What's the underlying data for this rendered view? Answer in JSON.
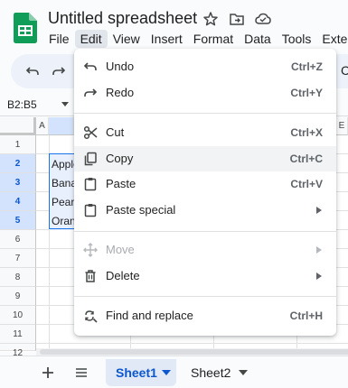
{
  "app": {
    "title": "Untitled spreadsheet",
    "menu": [
      "File",
      "Edit",
      "View",
      "Insert",
      "Format",
      "Data",
      "Tools",
      "Exte"
    ],
    "active_menu": "Edit"
  },
  "toolbar": {
    "overflow_letter": "C"
  },
  "formula_bar": {
    "range": "B2:B5"
  },
  "grid": {
    "columns": [
      "A",
      "",
      "E"
    ],
    "rows": [
      "1",
      "2",
      "3",
      "4",
      "5",
      "6",
      "7",
      "8",
      "9",
      "10",
      "11",
      "12"
    ],
    "selected_rows": [
      "2",
      "3",
      "4",
      "5"
    ],
    "cells_b": [
      "Apple",
      "Banana",
      "Pears",
      "Oranges"
    ]
  },
  "sheets": {
    "tabs": [
      "Sheet1",
      "Sheet2"
    ],
    "active": "Sheet1"
  },
  "edit_menu": {
    "items": [
      {
        "label": "Undo",
        "shortcut": "Ctrl+Z",
        "icon": "undo-icon"
      },
      {
        "label": "Redo",
        "shortcut": "Ctrl+Y",
        "icon": "redo-icon"
      },
      {
        "label": "Cut",
        "shortcut": "Ctrl+X",
        "icon": "scissors-icon"
      },
      {
        "label": "Copy",
        "shortcut": "Ctrl+C",
        "icon": "copy-icon"
      },
      {
        "label": "Paste",
        "shortcut": "Ctrl+V",
        "icon": "clipboard-icon"
      },
      {
        "label": "Paste special",
        "shortcut": "",
        "icon": "clipboard-icon"
      },
      {
        "label": "Move",
        "shortcut": "",
        "icon": "move-icon",
        "disabled": true
      },
      {
        "label": "Delete",
        "shortcut": "",
        "icon": "trash-icon"
      },
      {
        "label": "Find and replace",
        "shortcut": "Ctrl+H",
        "icon": "find-replace-icon"
      }
    ],
    "hovered": "Copy"
  },
  "colors": {
    "sheets_green": "#0f9d58",
    "selection_blue": "#1a73e8",
    "selected_header": "#d3e3fd",
    "active_tab_text": "#0b57d0",
    "toolbar_bg": "#edf2fa"
  }
}
